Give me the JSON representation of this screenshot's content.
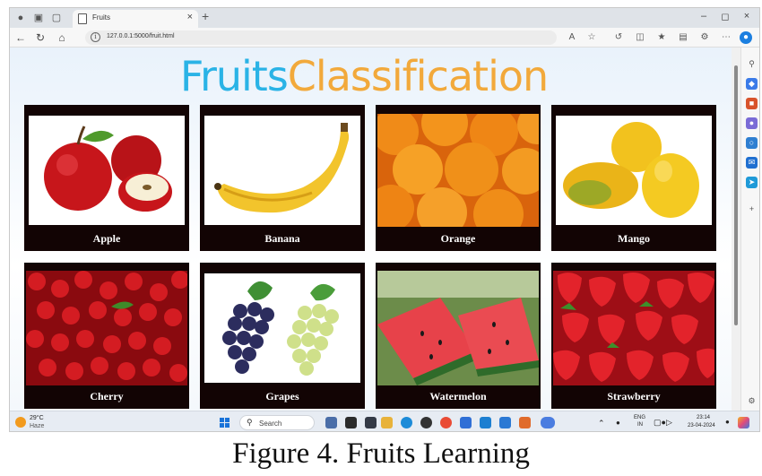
{
  "browser": {
    "tab_title": "Fruits",
    "url": "127.0.0.1:5000/fruit.html"
  },
  "page": {
    "title_part1": "Fruits",
    "title_part2": "Classification",
    "fruits": [
      {
        "label": "Apple",
        "image": "apple-image"
      },
      {
        "label": "Banana",
        "image": "banana-image"
      },
      {
        "label": "Orange",
        "image": "orange-image"
      },
      {
        "label": "Mango",
        "image": "mango-image"
      },
      {
        "label": "Cherry",
        "image": "cherry-image"
      },
      {
        "label": "Grapes",
        "image": "grapes-image"
      },
      {
        "label": "Watermelon",
        "image": "watermelon-image"
      },
      {
        "label": "Strawberry",
        "image": "strawberry-image"
      }
    ]
  },
  "taskbar": {
    "weather_temp": "29°C",
    "weather_condition": "Haze",
    "search_placeholder": "Search",
    "language": "ENG",
    "region": "IN",
    "time": "23:14",
    "date": "23-04-2024"
  },
  "caption": "Figure 4. Fruits Learning",
  "colors": {
    "title_blue": "#2ab3e6",
    "title_orange": "#f2a93b",
    "card_background": "#120404"
  }
}
